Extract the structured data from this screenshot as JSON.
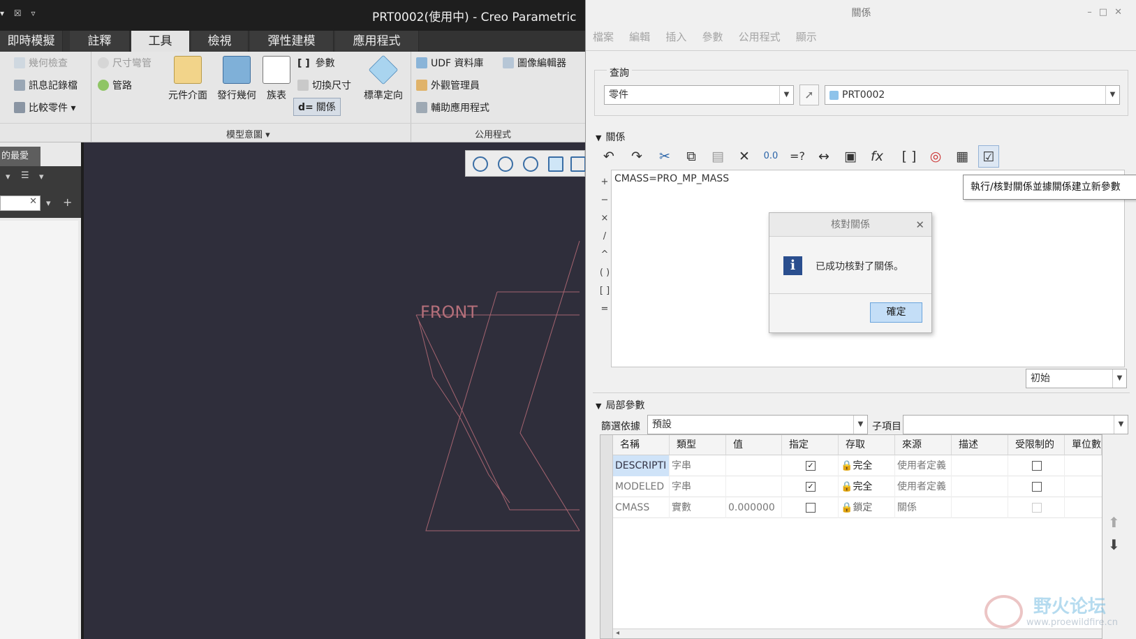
{
  "creo": {
    "window_title": "PRT0002(使用中) - Creo Parametric",
    "tabs": [
      "即時模擬",
      "註釋",
      "工具",
      "檢視",
      "彈性建模",
      "應用程式"
    ],
    "active_tab": "工具",
    "ribbon": {
      "geometry_check": "幾何檢查",
      "log_file": "訊息記錄檔",
      "compare_part": "比較零件",
      "dimension_bend": "尺寸彎管",
      "piping": "管路",
      "component_interface": "元件介面",
      "publish_geometry": "發行幾何",
      "family_table": "族表",
      "parameters": "參數",
      "switch_dimensions": "切換尺寸",
      "relations": "關係",
      "ref_orientation": "標準定向",
      "udf_library": "UDF 資料庫",
      "image_editor": "圖像編輯器",
      "appearance_manager": "外觀管理員",
      "aux_applications": "輔助應用程式",
      "group_model_intent": "模型意圖",
      "group_utilities": "公用程式"
    },
    "left_panel_tab": "的最愛",
    "datum_plane_label": "FRONT"
  },
  "relations_dialog": {
    "title": "關係",
    "menu": [
      "檔案",
      "編輯",
      "插入",
      "參數",
      "公用程式",
      "顯示"
    ],
    "lookup_label": "查詢",
    "lookup_type": "零件",
    "lookup_object": "PRT0002",
    "relations_section": "關係",
    "relation_text": "CMASS=PRO_MP_MASS",
    "side_symbols": [
      "+",
      "−",
      "×",
      "/",
      "^",
      "( )",
      "[ ]",
      "="
    ],
    "tooltip": "執行/核對關係並據關係建立新參數",
    "initial_combo": "初始",
    "local_params_section": "局部參數",
    "filter_label": "篩選依據",
    "filter_value": "預設",
    "sub_item_label": "子項目",
    "columns": [
      "名稱",
      "類型",
      "值",
      "指定",
      "存取",
      "來源",
      "描述",
      "受限制的",
      "單位數"
    ],
    "rows": [
      {
        "name": "DESCRIPTI",
        "type": "字串",
        "value": "",
        "designate": true,
        "access": "完全",
        "source": "使用者定義",
        "desc": "",
        "restricted": false
      },
      {
        "name": "MODELED",
        "type": "字串",
        "value": "",
        "designate": true,
        "access": "完全",
        "source": "使用者定義",
        "desc": "",
        "restricted": false
      },
      {
        "name": "CMASS",
        "type": "實數",
        "value": "0.000000",
        "designate": false,
        "access": "鎖定",
        "source": "關係",
        "desc": "",
        "restricted": false
      }
    ]
  },
  "verify_dialog": {
    "title": "核對關係",
    "message": "已成功核對了關係。",
    "ok_button": "確定"
  },
  "watermark": {
    "text": "野火论坛",
    "url": "www.proewildfire.cn"
  }
}
